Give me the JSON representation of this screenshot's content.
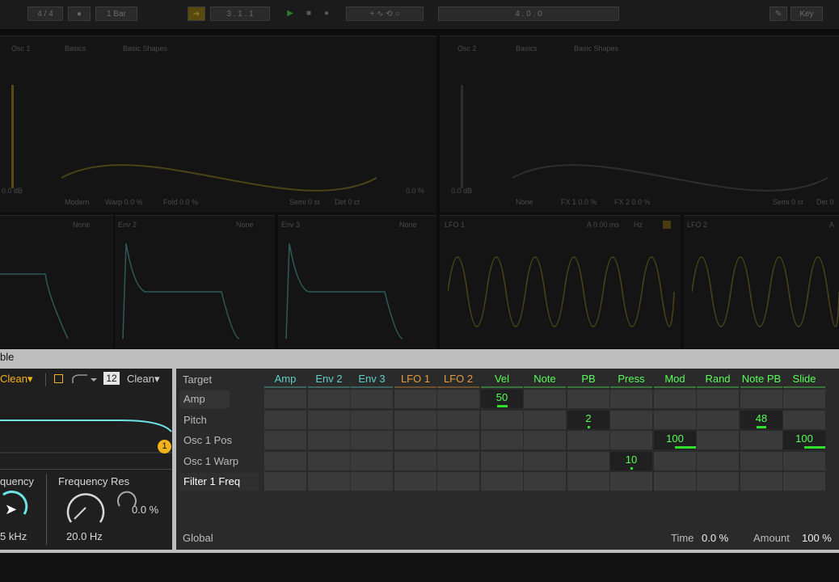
{
  "topbar": {
    "signature": "4 / 4",
    "quantize": "1 Bar",
    "position1": "3 . 1 . 1",
    "position2": "4 . 0 . 0",
    "key_label": "Key"
  },
  "osc1": {
    "title": "Osc 1",
    "category": "Basics",
    "wavetable": "Basic Shapes",
    "gain": "0.0 dB",
    "mode": "Modern",
    "warp": "Warp 0.0 %",
    "fold": "Fold 0.0 %",
    "semi": "Semi 0 st",
    "det": "Det 0 ct",
    "pos": "0.0 %"
  },
  "osc2": {
    "title": "Osc 2",
    "category": "Basics",
    "wavetable": "Basic Shapes",
    "gain": "0.0 dB",
    "mode": "None",
    "fx1": "FX 1 0.0 %",
    "fx2": "FX 2 0.0 %",
    "semi": "Semi 0 st",
    "det": "Det 0"
  },
  "envelopes": {
    "env1_none": "None",
    "env2": "Env 2",
    "env2_none": "None",
    "env3": "Env 3",
    "env3_none": "None"
  },
  "lfos": {
    "lfo1": "LFO 1",
    "lfo1_attack": "A 0.00 ms",
    "lfo1_rate": "Hz",
    "lfo2": "LFO 2",
    "lfo2_attack": "A"
  },
  "mod_panel": {
    "title": "ble"
  },
  "filter": {
    "circuit1": "Clean",
    "slope": "12",
    "circuit2": "Clean",
    "badge": "1",
    "freq_label": "quency",
    "freq_value": "5 kHz",
    "freqres_label": "Frequency Res",
    "freqres_value": "20.0 Hz",
    "res_value": "0.0 %"
  },
  "matrix": {
    "target_label": "Target",
    "global_label": "Global",
    "time_label": "Time",
    "time_value": "0.0 %",
    "amount_label": "Amount",
    "amount_value": "100 %",
    "sources": [
      {
        "label": "Amp",
        "color": "#5fd0c8"
      },
      {
        "label": "Env 2",
        "color": "#5fd0c8"
      },
      {
        "label": "Env 3",
        "color": "#5fd0c8"
      },
      {
        "label": "LFO 1",
        "color": "#e59a3c"
      },
      {
        "label": "LFO 2",
        "color": "#e59a3c"
      },
      {
        "label": "Vel",
        "color": "#58ff58"
      },
      {
        "label": "Note",
        "color": "#58ff58"
      },
      {
        "label": "PB",
        "color": "#58ff58"
      },
      {
        "label": "Press",
        "color": "#58ff58"
      },
      {
        "label": "Mod",
        "color": "#58ff58"
      },
      {
        "label": "Rand",
        "color": "#58ff58"
      },
      {
        "label": "Note PB",
        "color": "#58ff58"
      },
      {
        "label": "Slide",
        "color": "#58ff58"
      }
    ],
    "targets": [
      "Amp",
      "Pitch",
      "Osc 1 Pos",
      "Osc 1 Warp",
      "Filter 1 Freq"
    ],
    "values": [
      {
        "row": 0,
        "col": 5,
        "value": "50",
        "fraction": 0.5
      },
      {
        "row": 1,
        "col": 7,
        "value": "2",
        "fraction": 0.02
      },
      {
        "row": 1,
        "col": 11,
        "value": "48",
        "fraction": 0.48
      },
      {
        "row": 2,
        "col": 9,
        "value": "100",
        "fraction": 1.0
      },
      {
        "row": 2,
        "col": 12,
        "value": "100",
        "fraction": 1.0
      },
      {
        "row": 3,
        "col": 8,
        "value": "10",
        "fraction": 0.1
      }
    ]
  },
  "colors": {
    "accent_green": "#58ff58",
    "env_cyan": "#5fd0c8",
    "lfo_orange": "#e59a3c",
    "filter_cyan": "#6fe3e3",
    "badge_yellow": "#f2b21b"
  }
}
